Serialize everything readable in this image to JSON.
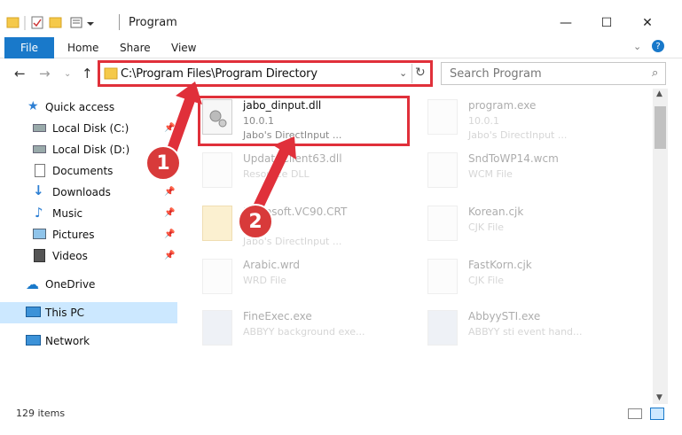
{
  "window": {
    "title": "Program",
    "controls": {
      "minimize": "—",
      "maximize": "☐",
      "close": "✕"
    }
  },
  "ribbon": {
    "tabs": [
      "File",
      "Home",
      "Share",
      "View"
    ],
    "help_icon": "?"
  },
  "nav": {
    "path": "C:\\Program Files\\Program Directory",
    "search_placeholder": "Search Program"
  },
  "sidebar": {
    "items": [
      {
        "label": "Quick access",
        "icon": "star-icon"
      },
      {
        "label": "Local Disk (C:)",
        "icon": "drive-icon"
      },
      {
        "label": "Local Disk (D:)",
        "icon": "drive-icon"
      },
      {
        "label": "Documents",
        "icon": "documents-icon"
      },
      {
        "label": "Downloads",
        "icon": "downloads-icon"
      },
      {
        "label": "Music",
        "icon": "music-icon"
      },
      {
        "label": "Pictures",
        "icon": "pictures-icon"
      },
      {
        "label": "Videos",
        "icon": "videos-icon"
      },
      {
        "label": "OneDrive",
        "icon": "cloud-icon"
      },
      {
        "label": "This PC",
        "icon": "computer-icon"
      },
      {
        "label": "Network",
        "icon": "network-icon"
      }
    ]
  },
  "files": [
    {
      "name": "jabo_dinput.dll",
      "line2": "10.0.1",
      "line3": "Jabo's DirectInput ..."
    },
    {
      "name": "program.exe",
      "line2": "10.0.1",
      "line3": "Jabo's DirectInput ..."
    },
    {
      "name": "UpdateClient63.dll",
      "line2": "Resource DLL",
      "line3": ""
    },
    {
      "name": "SndToWP14.wcm",
      "line2": "WCM File",
      "line3": ""
    },
    {
      "name": "Microsoft.VC90.CRT",
      "line2": "",
      "line3": "Jabo's DirectInput ..."
    },
    {
      "name": "Korean.cjk",
      "line2": "CJK File",
      "line3": ""
    },
    {
      "name": "Arabic.wrd",
      "line2": "WRD File",
      "line3": ""
    },
    {
      "name": "FastKorn.cjk",
      "line2": "CJK File",
      "line3": ""
    },
    {
      "name": "FineExec.exe",
      "line2": "ABBYY background exe...",
      "line3": ""
    },
    {
      "name": "AbbyySTI.exe",
      "line2": "ABBYY sti event hand...",
      "line3": ""
    }
  ],
  "annotations": {
    "step1": "1",
    "step2": "2"
  },
  "status": {
    "item_count": "129 items"
  }
}
